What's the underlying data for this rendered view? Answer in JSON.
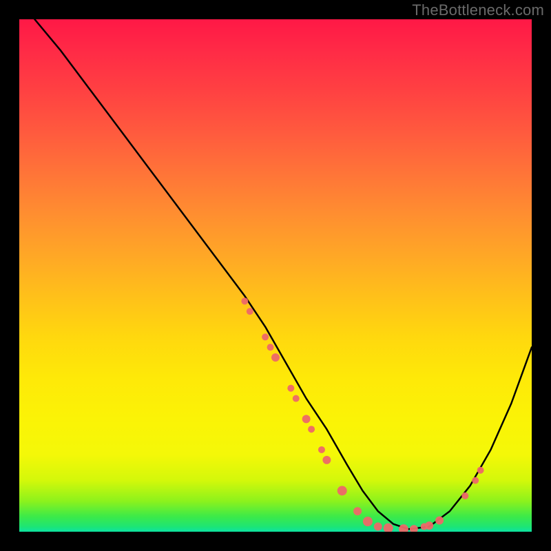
{
  "watermark": "TheBottleneck.com",
  "chart_data": {
    "type": "line",
    "title": "",
    "xlabel": "",
    "ylabel": "",
    "xlim": [
      0,
      100
    ],
    "ylim": [
      0,
      100
    ],
    "grid": false,
    "legend": false,
    "series": [
      {
        "name": "curve",
        "color": "#000000",
        "x": [
          3,
          8,
          14,
          20,
          26,
          32,
          38,
          44,
          48,
          52,
          56,
          60,
          64,
          67,
          70,
          73,
          76,
          80,
          84,
          88,
          92,
          96,
          100
        ],
        "y": [
          100,
          94,
          86,
          78,
          70,
          62,
          54,
          46,
          40,
          33,
          26,
          20,
          13,
          8,
          4,
          1.5,
          0.5,
          1,
          4,
          9,
          16,
          25,
          36
        ]
      }
    ],
    "markers": [
      {
        "x": 44,
        "y": 45,
        "r": 5
      },
      {
        "x": 45,
        "y": 43,
        "r": 5
      },
      {
        "x": 48,
        "y": 38,
        "r": 5
      },
      {
        "x": 49,
        "y": 36,
        "r": 5
      },
      {
        "x": 50,
        "y": 34,
        "r": 6
      },
      {
        "x": 53,
        "y": 28,
        "r": 5
      },
      {
        "x": 54,
        "y": 26,
        "r": 5
      },
      {
        "x": 56,
        "y": 22,
        "r": 6
      },
      {
        "x": 57,
        "y": 20,
        "r": 5
      },
      {
        "x": 59,
        "y": 16,
        "r": 5
      },
      {
        "x": 60,
        "y": 14,
        "r": 6
      },
      {
        "x": 63,
        "y": 8,
        "r": 7
      },
      {
        "x": 66,
        "y": 4,
        "r": 6
      },
      {
        "x": 68,
        "y": 2,
        "r": 7
      },
      {
        "x": 70,
        "y": 1,
        "r": 6
      },
      {
        "x": 72,
        "y": 0.7,
        "r": 7
      },
      {
        "x": 75,
        "y": 0.5,
        "r": 7
      },
      {
        "x": 77,
        "y": 0.5,
        "r": 6
      },
      {
        "x": 79,
        "y": 1,
        "r": 5
      },
      {
        "x": 80,
        "y": 1.2,
        "r": 6
      },
      {
        "x": 82,
        "y": 2.2,
        "r": 6
      },
      {
        "x": 87,
        "y": 7,
        "r": 5
      },
      {
        "x": 89,
        "y": 10,
        "r": 5
      },
      {
        "x": 90,
        "y": 12,
        "r": 5
      }
    ],
    "colors": {
      "curve": "#000000",
      "marker": "#ed6868",
      "gradient_top": "#ff1846",
      "gradient_bottom": "#0de2a2"
    }
  }
}
